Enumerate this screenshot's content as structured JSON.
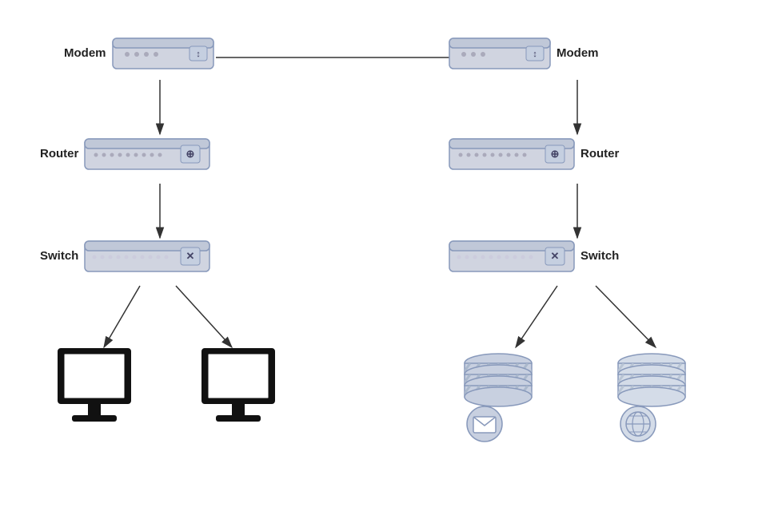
{
  "nodes": {
    "left": {
      "modem_label": "Modem",
      "router_label": "Router",
      "switch_label": "Switch"
    },
    "right": {
      "modem_label": "Modem",
      "router_label": "Router",
      "switch_label": "Switch"
    }
  }
}
